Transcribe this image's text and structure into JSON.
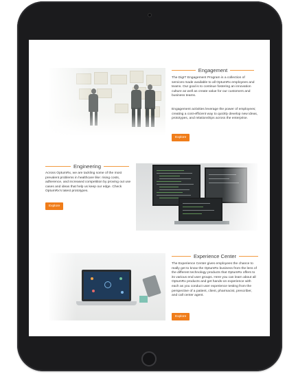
{
  "sections": {
    "engagement": {
      "title": "Engagement",
      "para1": "The DigIT Engagement Program is a collection of services made available to all OptumRx employees and teams. Our goal is to continue fostering an innovation culture as well as create value for our customers and business teams.",
      "para2": "Engagement activities leverage the power of employees; creating a cost-efficient way to quickly develop new ideas, prototypes, and relationships across the enterprise.",
      "button": "Explore"
    },
    "engineering": {
      "title": "Engineering",
      "para1": "Across OptumRx, we are tackling some of the most prevalent problems in healthcare like: rising costs, adherence, and increased competition by proving out use cases and ideas that help us keep our edge. Check OptumRx's latest prototypes.",
      "button": "Explore"
    },
    "experience": {
      "title": "Experience Center",
      "para1": "The Experience Center gives employees the chance to really get to know the OptumRx business from the lens of the different technology products that OptumRx offers to its various end user groups. Here you can learn about all OptumRx products and get hands-on experience with each as you conduct user experience testing from the perspective of a patient, client, pharmacist, prescriber, and call center agent.",
      "button": "Explore"
    }
  },
  "colors": {
    "accent": "#f07d1a",
    "rule": "#f29a3f",
    "device": "#1b1b1d"
  }
}
